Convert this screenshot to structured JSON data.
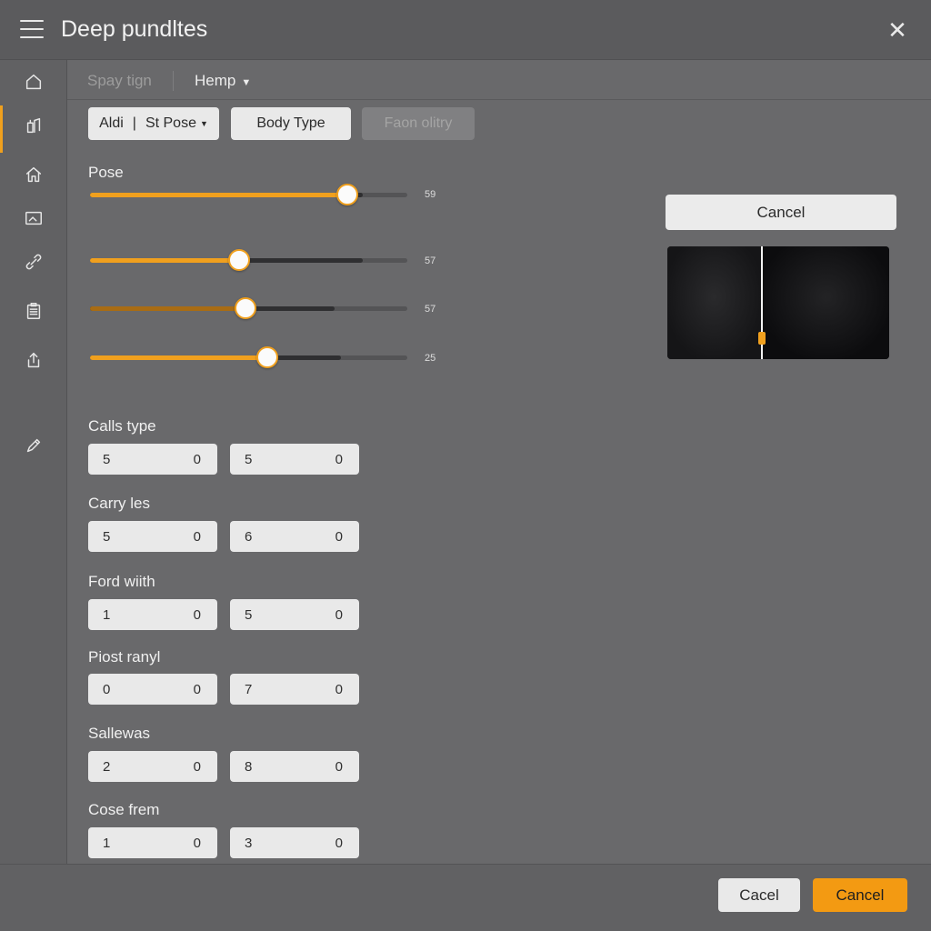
{
  "window": {
    "title": "Deep pundltes"
  },
  "toolbar": {
    "search_text": "Spay tign",
    "menu_label": "Hemp"
  },
  "tabs": {
    "first_a": "Aldi",
    "first_sep": "|",
    "first_b": "St Pose",
    "second": "Body Type",
    "third": "Faon olitry"
  },
  "pose": {
    "label": "Pose",
    "sliders": [
      {
        "value_text": "59",
        "fill_pct": 81,
        "dark_pct": 86
      },
      {
        "value_text": "57",
        "fill_pct": 47,
        "dark_pct": 86
      },
      {
        "value_text": "57",
        "fill_pct": 49,
        "dark_pct": 77
      },
      {
        "value_text": "25",
        "fill_pct": 56,
        "dark_pct": 79
      }
    ]
  },
  "fields": [
    {
      "label": "Calls type",
      "left": [
        "5",
        "0"
      ],
      "right": [
        "5",
        "0"
      ]
    },
    {
      "label": "Carry les",
      "left": [
        "5",
        "0"
      ],
      "right": [
        "6",
        "0"
      ]
    },
    {
      "label": "Ford wiith",
      "left": [
        "1",
        "0"
      ],
      "right": [
        "5",
        "0"
      ]
    },
    {
      "label": "Piost ranyl",
      "left": [
        "0",
        "0"
      ],
      "right": [
        "7",
        "0"
      ]
    },
    {
      "label": "Sallewas",
      "left": [
        "2",
        "0"
      ],
      "right": [
        "8",
        "0"
      ]
    },
    {
      "label": "Cose frem",
      "left": [
        "1",
        "0"
      ],
      "right": [
        "3",
        "0"
      ]
    }
  ],
  "preview": {
    "cancel_label": "Cancel"
  },
  "footer": {
    "secondary_label": "Cacel",
    "primary_label": "Cancel"
  },
  "colors": {
    "accent": "#f0a01e",
    "background": "#69696b",
    "field_bg": "#e9e9e9"
  },
  "icons": {
    "sidebar": [
      "home-icon",
      "pose-icon",
      "house-icon",
      "image-icon",
      "link-icon",
      "clipboard-icon",
      "share-icon",
      "pen-icon"
    ]
  }
}
